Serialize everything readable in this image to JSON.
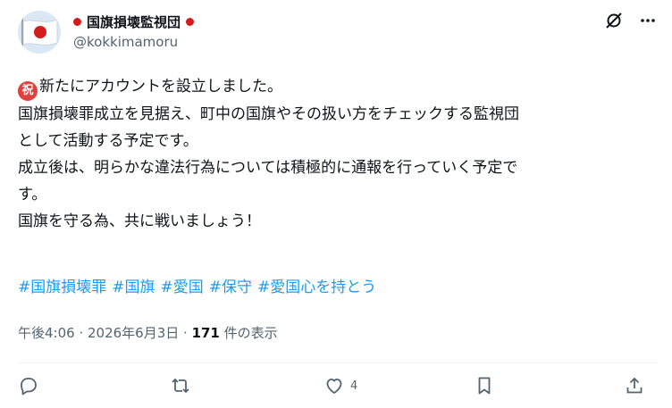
{
  "post": {
    "author": {
      "display_name": "国旗損壊監視団",
      "handle": "@kokkimamoru",
      "avatar_icon": "japan-flag-avatar",
      "badge_color": "#d51c1c"
    },
    "emoji_label": "祝",
    "body_lines": [
      "新たにアカウントを設立しました。",
      "国旗損壊罪成立を見据え、町中の国旗やその扱い方をチェックする監視団",
      "として活動する予定です。",
      "成立後は、明らかな違法行為については積極的に通報を行っていく予定で",
      "す。",
      "国旗を守る為、共に戦いましょう！"
    ],
    "hashtags": [
      "#国旗損壊罪",
      "#国旗",
      "#愛国",
      "#保守",
      "#愛国心を持とう"
    ],
    "timestamp": "午後4:06 · 2026年6月3日 · ",
    "views_count": "171",
    "views_label": " 件の表示",
    "likes_count": "4",
    "accent_color": "#1d9bf0"
  }
}
